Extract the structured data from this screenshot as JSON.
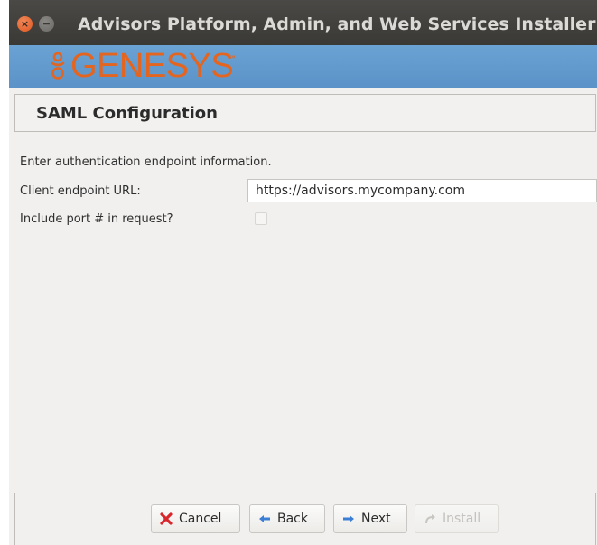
{
  "window": {
    "title": "Advisors Platform, Admin, and Web Services Installer",
    "close_glyph": "×",
    "minimize_glyph": "−"
  },
  "banner": {
    "logo_text": "GENESYS",
    "logo_tm": "™",
    "brand_color": "#e4651f",
    "banner_color": "#5b93c8"
  },
  "section": {
    "title": "SAML Configuration"
  },
  "form": {
    "instructions": "Enter authentication endpoint information.",
    "endpoint_label": "Client endpoint URL:",
    "endpoint_value": "https://advisors.mycompany.com",
    "port_label": "Include port # in request?",
    "port_checked": false
  },
  "buttons": {
    "cancel": {
      "label": "Cancel",
      "icon": "cancel-x-icon",
      "enabled": true
    },
    "back": {
      "label": "Back",
      "icon": "arrow-left-icon",
      "enabled": true
    },
    "next": {
      "label": "Next",
      "icon": "arrow-right-icon",
      "enabled": true
    },
    "install": {
      "label": "Install",
      "icon": "redo-arrow-icon",
      "enabled": false
    }
  }
}
